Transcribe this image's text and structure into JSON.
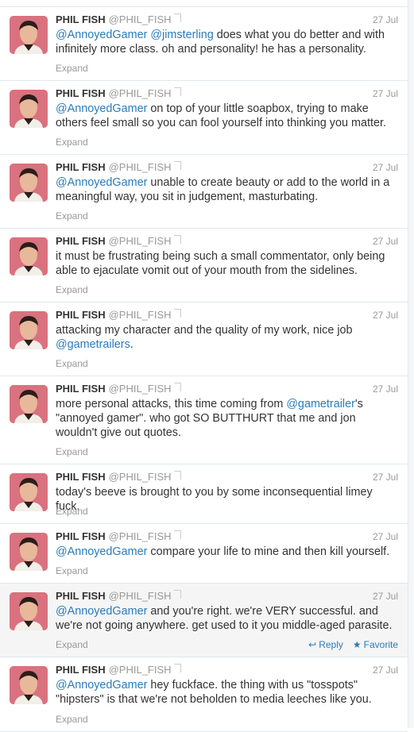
{
  "tweets": [
    {
      "name": "PHIL FISH",
      "handle": "@PHIL_FISH",
      "time": "27 Jul",
      "parts": [
        {
          "m": "@AnnoyedGamer"
        },
        {
          "t": " "
        },
        {
          "m": "@jimsterling"
        },
        {
          "t": " does what you do better and with infinitely more class. oh and personality! he has a personality."
        }
      ],
      "expand": "Expand"
    },
    {
      "name": "PHIL FISH",
      "handle": "@PHIL_FISH",
      "time": "27 Jul",
      "parts": [
        {
          "m": "@AnnoyedGamer"
        },
        {
          "t": " on top of your little soapbox, trying to make others feel small so you can fool yourself into thinking you matter."
        }
      ],
      "expand": "Expand"
    },
    {
      "name": "PHIL FISH",
      "handle": "@PHIL_FISH",
      "time": "27 Jul",
      "parts": [
        {
          "m": "@AnnoyedGamer"
        },
        {
          "t": " unable to create beauty or add to the world in a meaningful way, you sit in judgement, masturbating."
        }
      ],
      "expand": "Expand"
    },
    {
      "name": "PHIL FISH",
      "handle": "@PHIL_FISH",
      "time": "27 Jul",
      "parts": [
        {
          "t": "it must be frustrating being such a small commentator, only being able to ejaculate vomit out of your mouth from the sidelines."
        }
      ],
      "expand": "Expand"
    },
    {
      "name": "PHIL FISH",
      "handle": "@PHIL_FISH",
      "time": "27 Jul",
      "parts": [
        {
          "t": "attacking my character and the quality of my work, nice job  "
        },
        {
          "m": "@gametrailers"
        },
        {
          "t": "."
        }
      ],
      "expand": "Expand"
    },
    {
      "name": "PHIL FISH",
      "handle": "@PHIL_FISH",
      "time": "27 Jul",
      "parts": [
        {
          "t": "more personal attacks, this time coming from "
        },
        {
          "m": "@gametrailer"
        },
        {
          "t": "'s \"annoyed gamer\". who got SO BUTTHURT that me and jon wouldn't give out quotes."
        }
      ],
      "expand": "Expand"
    },
    {
      "name": "PHIL FISH",
      "handle": "@PHIL_FISH",
      "time": "27 Jul",
      "parts": [
        {
          "t": "today's beeve is brought to you by some inconsequential limey fuck."
        }
      ],
      "expand": "Expand"
    },
    {
      "name": "PHIL FISH",
      "handle": "@PHIL_FISH",
      "time": "27 Jul",
      "parts": [
        {
          "m": "@AnnoyedGamer"
        },
        {
          "t": " compare your life to mine and then kill yourself."
        }
      ],
      "expand": "Expand"
    },
    {
      "name": "PHIL FISH",
      "handle": "@PHIL_FISH",
      "time": "27 Jul",
      "parts": [
        {
          "m": "@AnnoyedGamer"
        },
        {
          "t": " and you're right. we're VERY successful. and we're not going anywhere. get used to it you middle-aged parasite."
        }
      ],
      "expand": "Expand",
      "actions": {
        "reply": "Reply",
        "favorite": "Favorite"
      }
    },
    {
      "name": "PHIL FISH",
      "handle": "@PHIL_FISH",
      "time": "27 Jul",
      "parts": [
        {
          "m": "@AnnoyedGamer"
        },
        {
          "t": " hey fuckface. the thing with us \"tosspots\" \"hipsters\" is that we're not beholden to media leeches like you."
        }
      ],
      "expand": "Expand"
    }
  ],
  "icons": {
    "reply": "reply-icon",
    "favorite": "star-icon"
  },
  "colors": {
    "mention": "#2b7bb9",
    "muted": "#999999",
    "hover_bg": "#f5f5f5",
    "avatar_bg": "#d9727e"
  }
}
